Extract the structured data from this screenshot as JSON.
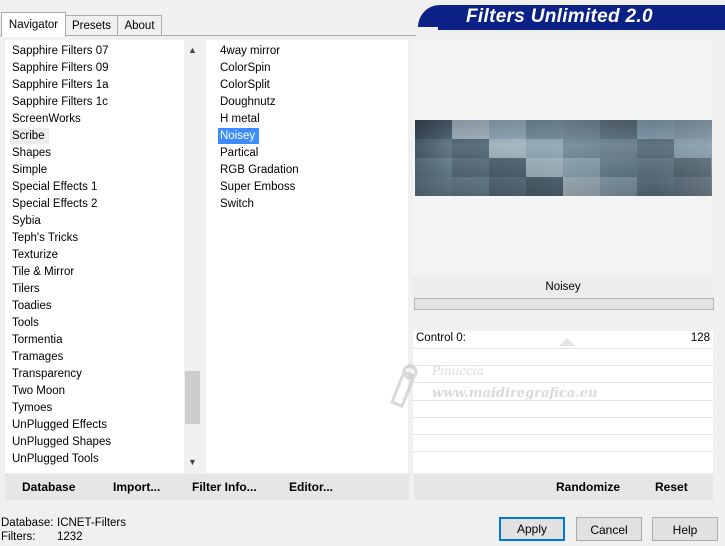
{
  "tabs": [
    {
      "label": "Navigator",
      "active": true
    },
    {
      "label": "Presets",
      "active": false
    },
    {
      "label": "About",
      "active": false
    }
  ],
  "banner": {
    "title": "Filters Unlimited 2.0",
    "color": "#0b2186"
  },
  "categories": {
    "items": [
      "Sapphire Filters 07",
      "Sapphire Filters 09",
      "Sapphire Filters 1a",
      "Sapphire Filters 1c",
      "ScreenWorks",
      "Scribe",
      "Shapes",
      "Simple",
      "Special Effects 1",
      "Special Effects 2",
      "Sybia",
      "Teph's Tricks",
      "Texturize",
      "Tile & Mirror",
      "Tilers",
      "Toadies",
      "Tools",
      "Tormentia",
      "Tramages",
      "Transparency",
      "Two Moon",
      "Tymoes",
      "UnPlugged Effects",
      "UnPlugged Shapes",
      "UnPlugged Tools"
    ],
    "highlighted": "Scribe",
    "scroll_up_icon": "up-arrow-icon",
    "scroll_down_icon": "down-arrow-icon"
  },
  "filters": {
    "items": [
      "4way mirror",
      "ColorSpin",
      "ColorSplit",
      "Doughnutz",
      "H metal",
      "Noisey",
      "Partical",
      "RGB Gradation",
      "Super Emboss",
      "Switch"
    ],
    "selected": "Noisey",
    "selected_color": "#3c8cff"
  },
  "preview": {
    "filter_name": "Noisey",
    "control_label": "Control 0:",
    "control_value": "128"
  },
  "toolbar_left": {
    "database": "Database",
    "import": "Import...",
    "filter_info": "Filter Info...",
    "editor": "Editor..."
  },
  "toolbar_right": {
    "randomize": "Randomize",
    "reset": "Reset"
  },
  "status": {
    "database_label": "Database:",
    "database_value": "ICNET-Filters",
    "filters_label": "Filters:",
    "filters_value": "1232"
  },
  "buttons": {
    "apply": "Apply",
    "cancel": "Cancel",
    "help": "Help"
  },
  "watermark": {
    "line1": "Pinuccia",
    "line2": "www.maidiregrafica.eu",
    "icon": "pen-icon"
  }
}
